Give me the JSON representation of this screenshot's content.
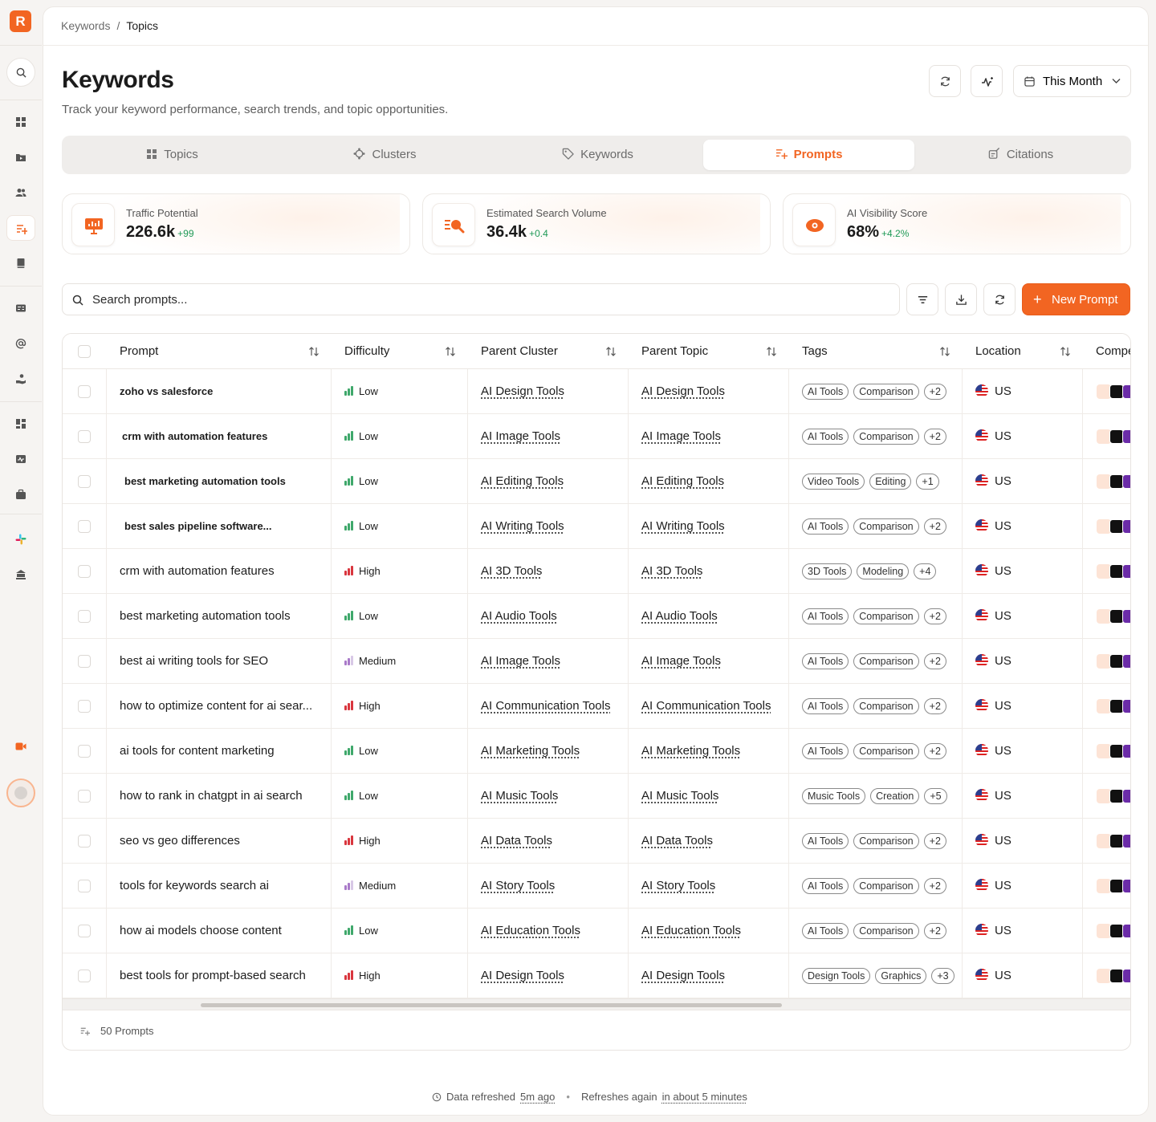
{
  "app": {
    "logo_letter": "R"
  },
  "sidebar": {
    "items": [
      {
        "icon": "grid-icon",
        "active": false
      },
      {
        "icon": "video-folder-icon",
        "active": false
      },
      {
        "icon": "users-icon",
        "active": false
      },
      {
        "icon": "prompts-icon",
        "active": true
      },
      {
        "icon": "book-icon",
        "active": false
      },
      {
        "icon": "id-card-icon",
        "active": false
      },
      {
        "icon": "at-sign-icon",
        "active": false
      },
      {
        "icon": "hand-user-icon",
        "active": false
      },
      {
        "icon": "dashboard-icon",
        "active": false
      },
      {
        "icon": "activity-card-icon",
        "active": false
      },
      {
        "icon": "briefcase-icon",
        "active": false
      },
      {
        "icon": "slack-icon",
        "active": false
      },
      {
        "icon": "agent-icon",
        "active": false
      },
      {
        "icon": "video-call-icon",
        "active": false
      }
    ]
  },
  "breadcrumb": {
    "parent": "Keywords",
    "separator": "/",
    "current": "Topics"
  },
  "header": {
    "title": "Keywords",
    "subtitle": "Track your keyword performance, search trends, and topic opportunities.",
    "date_range": "This Month"
  },
  "tabs": [
    {
      "label": "Topics",
      "icon": "grid-icon",
      "active": false
    },
    {
      "label": "Clusters",
      "icon": "cluster-icon",
      "active": false
    },
    {
      "label": "Keywords",
      "icon": "tag-icon",
      "active": false
    },
    {
      "label": "Prompts",
      "icon": "prompts-icon",
      "active": true
    },
    {
      "label": "Citations",
      "icon": "citation-icon",
      "active": false
    }
  ],
  "stats": [
    {
      "label": "Traffic Potential",
      "value": "226.6k",
      "delta": "+99",
      "icon": "presentation-chart-icon"
    },
    {
      "label": "Estimated Search Volume",
      "value": "36.4k",
      "delta": "+0.4",
      "icon": "search-list-icon"
    },
    {
      "label": "AI Visibility Score",
      "value": "68%",
      "delta": "+4.2%",
      "icon": "eye-cloud-icon"
    }
  ],
  "toolbar": {
    "search_placeholder": "Search prompts...",
    "new_button": "New Prompt"
  },
  "table": {
    "columns": [
      "Prompt",
      "Difficulty",
      "Parent Cluster",
      "Parent Topic",
      "Tags",
      "Location",
      "Compe"
    ],
    "rows": [
      {
        "prompt": "zoho vs salesforce",
        "bold": true,
        "difficulty": "Low",
        "cluster": "AI Design Tools",
        "topic": "AI Design Tools",
        "tags": [
          "AI Tools",
          "Comparison",
          "+2"
        ],
        "location": "US"
      },
      {
        "prompt": "crm with automation features",
        "bold": true,
        "difficulty": "Low",
        "cluster": "AI Image Tools",
        "topic": "AI Image Tools",
        "tags": [
          "AI Tools",
          "Comparison",
          "+2"
        ],
        "location": "US"
      },
      {
        "prompt": "best marketing automation tools",
        "bold": true,
        "difficulty": "Low",
        "cluster": "AI Editing Tools",
        "topic": "AI Editing Tools",
        "tags": [
          "Video Tools",
          "Editing",
          "+1"
        ],
        "location": "US"
      },
      {
        "prompt": "best sales pipeline software...",
        "bold": true,
        "difficulty": "Low",
        "cluster": "AI Writing Tools",
        "topic": "AI Writing Tools",
        "tags": [
          "AI Tools",
          "Comparison",
          "+2"
        ],
        "location": "US"
      },
      {
        "prompt": "crm with automation features",
        "bold": false,
        "difficulty": "High",
        "cluster": "AI 3D Tools",
        "topic": "AI 3D Tools",
        "tags": [
          "3D Tools",
          "Modeling",
          "+4"
        ],
        "location": "US"
      },
      {
        "prompt": "best marketing automation tools",
        "bold": false,
        "difficulty": "Low",
        "cluster": "AI Audio Tools",
        "topic": "AI Audio Tools",
        "tags": [
          "AI Tools",
          "Comparison",
          "+2"
        ],
        "location": "US"
      },
      {
        "prompt": "best ai writing tools for SEO",
        "bold": false,
        "difficulty": "Medium",
        "cluster": "AI Image Tools",
        "topic": "AI Image Tools",
        "tags": [
          "AI Tools",
          "Comparison",
          "+2"
        ],
        "location": "US"
      },
      {
        "prompt": "how to optimize content for ai sear...",
        "bold": false,
        "difficulty": "High",
        "cluster": "AI Communication Tools",
        "topic": "AI Communication Tools",
        "tags": [
          "AI Tools",
          "Comparison",
          "+2"
        ],
        "location": "US"
      },
      {
        "prompt": "ai tools for content marketing",
        "bold": false,
        "difficulty": "Low",
        "cluster": "AI Marketing Tools",
        "topic": "AI Marketing Tools",
        "tags": [
          "AI Tools",
          "Comparison",
          "+2"
        ],
        "location": "US"
      },
      {
        "prompt": "how to rank in chatgpt in ai search",
        "bold": false,
        "difficulty": "Low",
        "cluster": "AI Music Tools",
        "topic": "AI Music Tools",
        "tags": [
          "Music Tools",
          "Creation",
          "+5"
        ],
        "location": "US"
      },
      {
        "prompt": "seo vs geo differences",
        "bold": false,
        "difficulty": "High",
        "cluster": "AI Data Tools",
        "topic": "AI Data Tools",
        "tags": [
          "AI Tools",
          "Comparison",
          "+2"
        ],
        "location": "US"
      },
      {
        "prompt": "tools for keywords search ai",
        "bold": false,
        "difficulty": "Medium",
        "cluster": "AI Story Tools",
        "topic": "AI Story Tools",
        "tags": [
          "AI Tools",
          "Comparison",
          "+2"
        ],
        "location": "US"
      },
      {
        "prompt": "how ai models choose content",
        "bold": false,
        "difficulty": "Low",
        "cluster": "AI Education Tools",
        "topic": "AI Education Tools",
        "tags": [
          "AI Tools",
          "Comparison",
          "+2"
        ],
        "location": "US"
      },
      {
        "prompt": "best tools for prompt-based search",
        "bold": false,
        "difficulty": "High",
        "cluster": "AI Design Tools",
        "topic": "AI Design Tools",
        "tags": [
          "Design Tools",
          "Graphics",
          "+3"
        ],
        "location": "US"
      }
    ],
    "footer_count": "50 Prompts"
  },
  "status_bar": {
    "refreshed_label": "Data refreshed",
    "refreshed_value": "5m ago",
    "next_label": "Refreshes again",
    "next_value": "in about 5 minutes"
  },
  "colors": {
    "accent": "#f26522",
    "positive": "#1f9a57",
    "difficulty_low": "#3fa86b",
    "difficulty_medium": "#a97ac9",
    "difficulty_high": "#d9363e"
  }
}
